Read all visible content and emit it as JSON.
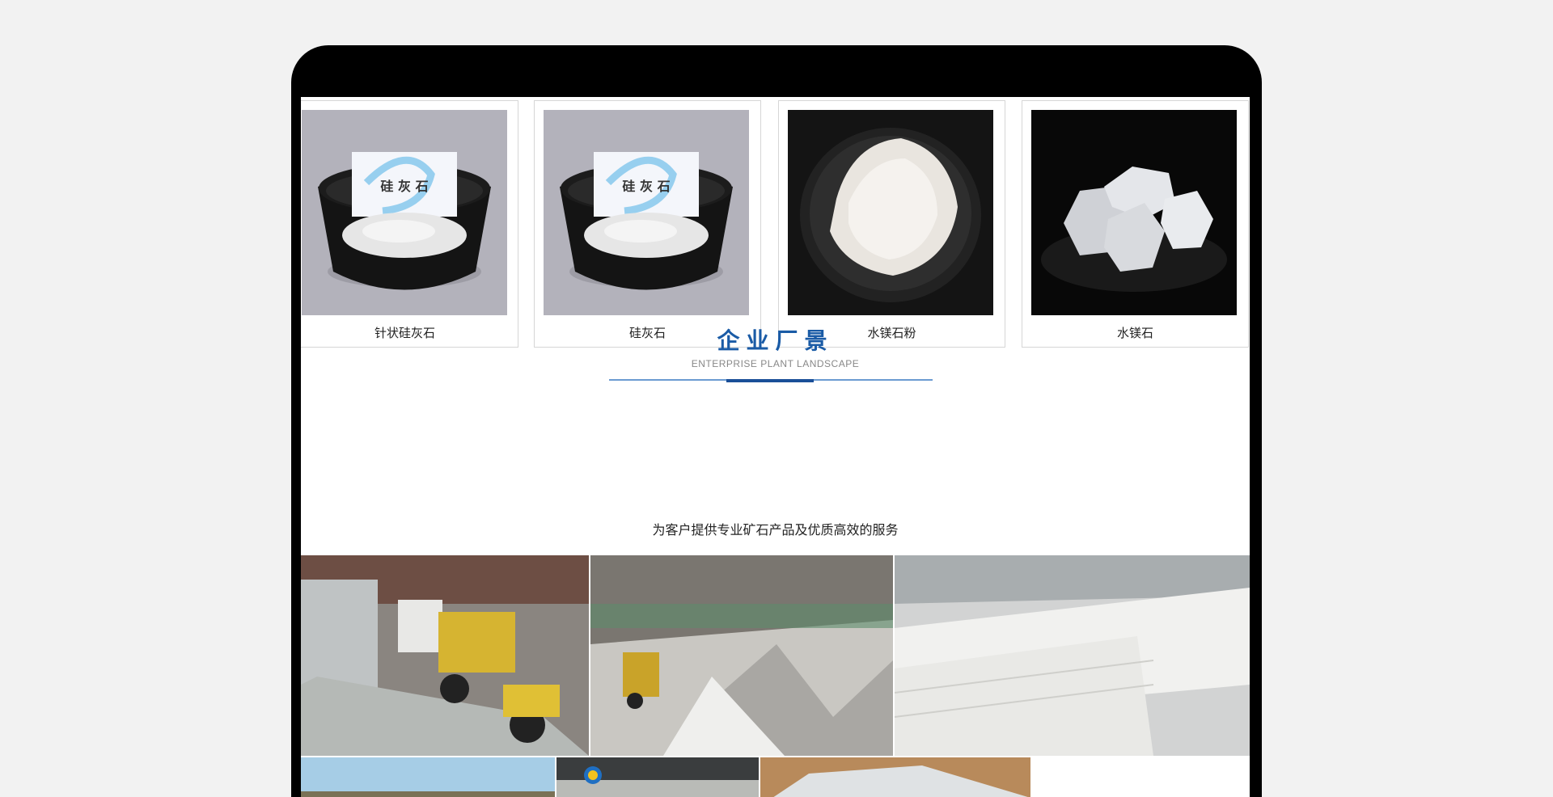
{
  "products": [
    {
      "name": "针状硅灰石",
      "card_text": "硅 灰 石"
    },
    {
      "name": "硅灰石",
      "card_text": "硅 灰 石"
    },
    {
      "name": "水镁石粉"
    },
    {
      "name": "水镁石"
    }
  ],
  "section": {
    "title": "企业厂景",
    "subtitle": "ENTERPRISE PLANT LANDSCAPE",
    "description": "为客户提供专业矿石产品及优质高效的服务"
  },
  "colors": {
    "accent": "#1a5ba6",
    "page_bg": "#f2f2f2",
    "frame": "#000000"
  }
}
